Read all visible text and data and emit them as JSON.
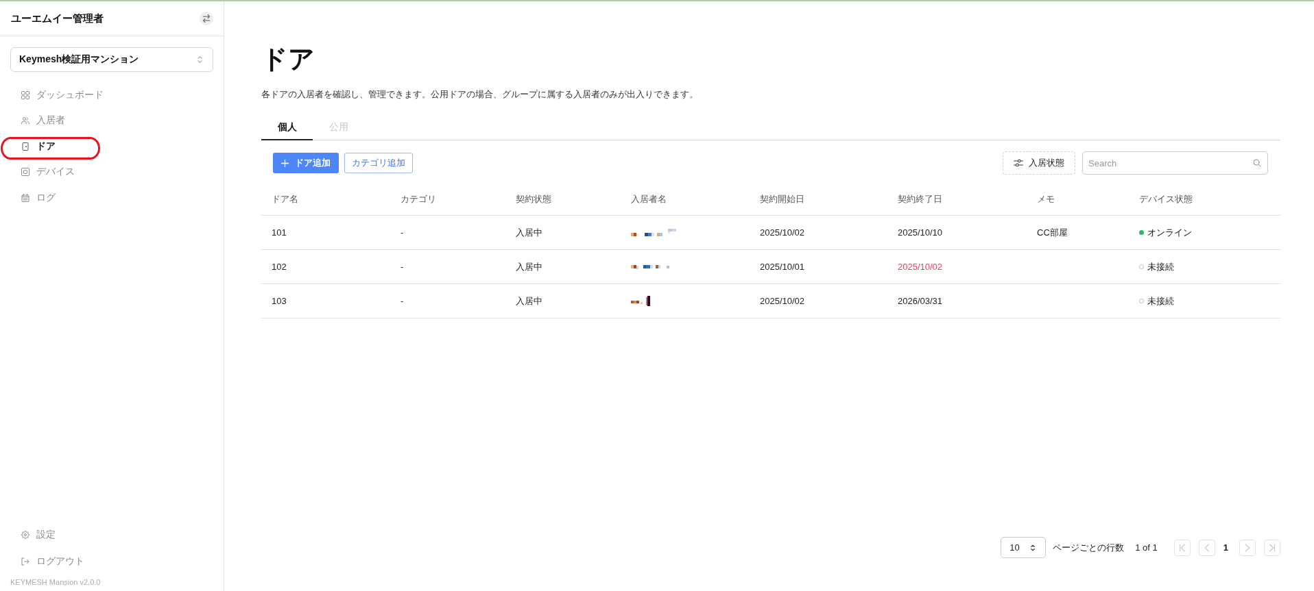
{
  "sidebar": {
    "title": "ユーエムイー管理者",
    "property_select": {
      "value": "Keymesh検証用マンション"
    },
    "items": [
      {
        "label": "ダッシュボード",
        "selected": false,
        "highlighted": false
      },
      {
        "label": "入居者",
        "selected": false,
        "highlighted": false
      },
      {
        "label": "ドア",
        "selected": true,
        "highlighted": true
      },
      {
        "label": "デバイス",
        "selected": false,
        "highlighted": false
      },
      {
        "label": "ログ",
        "selected": false,
        "highlighted": false
      }
    ],
    "footer_items": [
      {
        "label": "設定"
      },
      {
        "label": "ログアウト"
      }
    ],
    "version": "KEYMESH Mansion v2.0.0"
  },
  "page": {
    "title": "ドア",
    "description": "各ドアの入居者を確認し、管理できます。公用ドアの場合、グループに属する入居者のみが出入りできます。"
  },
  "tabs": [
    {
      "label": "個人",
      "selected": true
    },
    {
      "label": "公用",
      "selected": false
    }
  ],
  "toolbar": {
    "add_button": "ドア追加",
    "category_button": "カテゴリ追加",
    "filter_button": "入居状態",
    "search": {
      "placeholder": "Search"
    }
  },
  "table": {
    "columns": [
      "ドア名",
      "カテゴリ",
      "契約状態",
      "入居者名",
      "契約開始日",
      "契約終了日",
      "メモ",
      "デバイス状態"
    ],
    "rows": [
      {
        "door": "101",
        "category": "-",
        "contract_status": "入居中",
        "resident_redacted": true,
        "start_date": "2025/10/02",
        "end_date": "2025/10/10",
        "end_date_alert": false,
        "memo": "CC部屋",
        "device_status": "オンライン",
        "device_online": true
      },
      {
        "door": "102",
        "category": "-",
        "contract_status": "入居中",
        "resident_redacted": true,
        "start_date": "2025/10/01",
        "end_date": "2025/10/02",
        "end_date_alert": true,
        "device_status": "未接続",
        "device_online": false
      },
      {
        "door": "103",
        "category": "-",
        "contract_status": "入居中",
        "resident_redacted": true,
        "start_date": "2025/10/02",
        "end_date": "2026/03/31",
        "end_date_alert": false,
        "device_status": "未接続",
        "device_online": false
      }
    ]
  },
  "pagination": {
    "rows_per_page": "10",
    "rows_label": "ページごとの行数",
    "page_info": "1 of 1",
    "current_page": "1",
    "first_disabled": true,
    "prev_disabled": true,
    "next_disabled": true,
    "last_disabled": true
  }
}
